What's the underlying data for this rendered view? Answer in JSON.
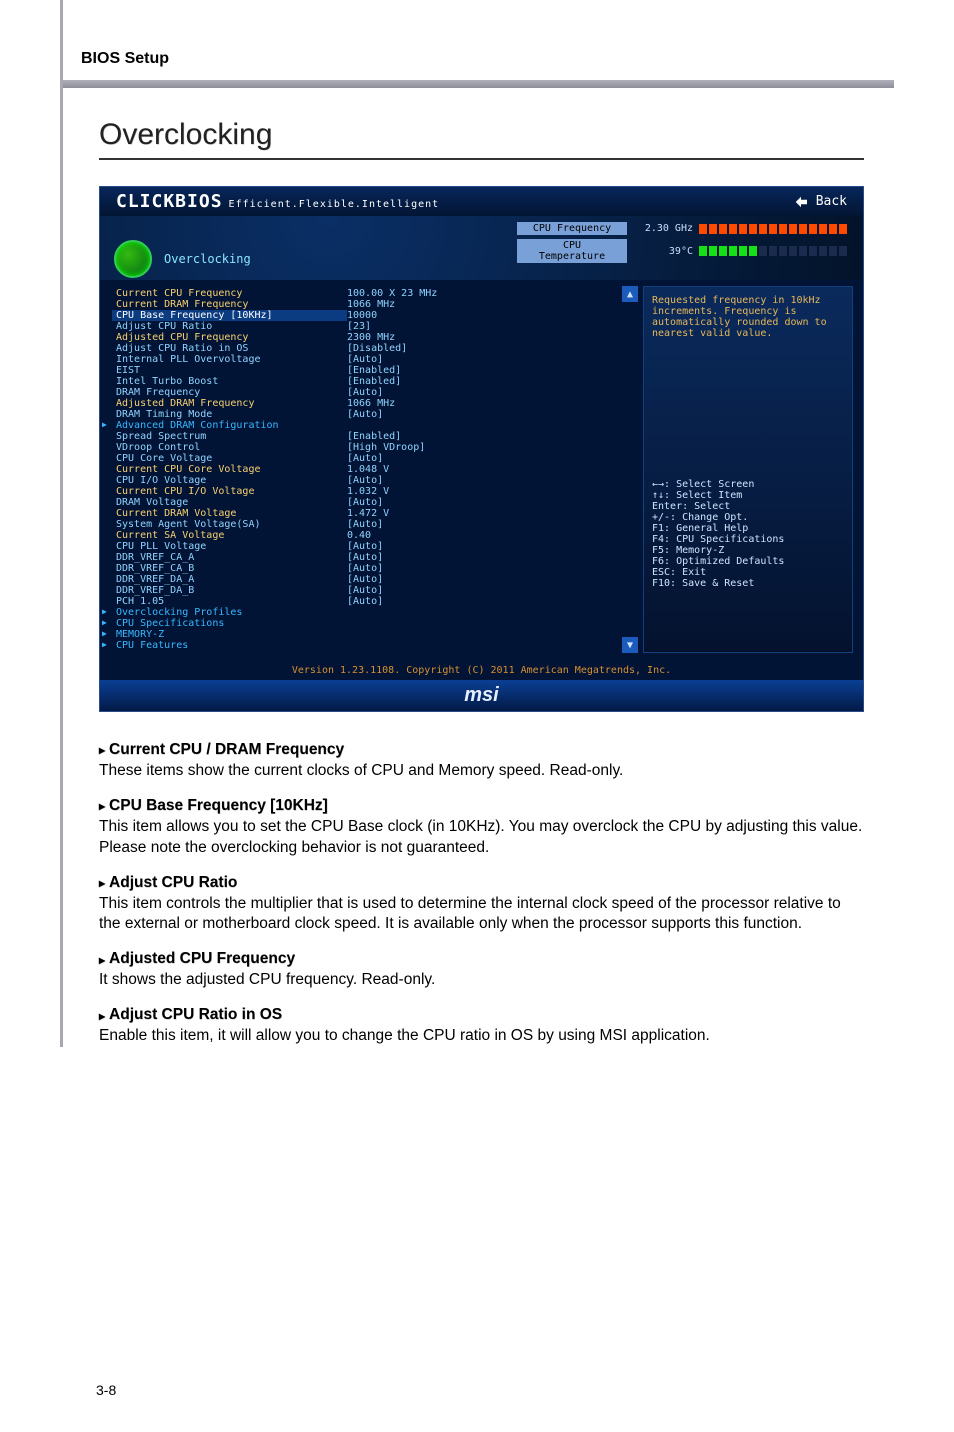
{
  "page": {
    "header": "BIOS Setup",
    "title": "Overclocking",
    "page_number": "3-8"
  },
  "bios": {
    "logo": "CLICKBIOS",
    "logo_tag": "Efficient.Flexible.Intelligent",
    "back": "Back",
    "section_label": "Overclocking",
    "gauges": {
      "cpu_freq_label": "CPU Frequency",
      "cpu_freq_value": "2.30 GHz",
      "cpu_temp_label": "CPU Temperature",
      "cpu_temp_value": "39°C"
    },
    "settings": [
      {
        "k": "Current CPU Frequency",
        "v": "100.00 X 23 MHz",
        "cls": "hl"
      },
      {
        "k": "Current DRAM Frequency",
        "v": "1066 MHz",
        "cls": "hl"
      },
      {
        "k": "CPU Base Frequency [10KHz]",
        "v": "10000",
        "cls": "sel"
      },
      {
        "k": "Adjust CPU Ratio",
        "v": "[23]",
        "cls": ""
      },
      {
        "k": "Adjusted CPU Frequency",
        "v": "2300 MHz",
        "cls": "hl"
      },
      {
        "k": "Adjust CPU Ratio in OS",
        "v": "[Disabled]",
        "cls": ""
      },
      {
        "k": "Internal PLL Overvoltage",
        "v": "[Auto]",
        "cls": ""
      },
      {
        "k": "EIST",
        "v": "[Enabled]",
        "cls": ""
      },
      {
        "k": "Intel Turbo Boost",
        "v": "[Enabled]",
        "cls": ""
      },
      {
        "k": "DRAM Frequency",
        "v": "[Auto]",
        "cls": ""
      },
      {
        "k": "Adjusted DRAM Frequency",
        "v": "1066 MHz",
        "cls": "hl"
      },
      {
        "k": "DRAM Timing Mode",
        "v": "[Auto]",
        "cls": ""
      },
      {
        "k": "Advanced DRAM Configuration",
        "v": "",
        "cls": "submenu"
      },
      {
        "k": "Spread Spectrum",
        "v": "[Enabled]",
        "cls": ""
      },
      {
        "k": "VDroop Control",
        "v": "[High VDroop]",
        "cls": ""
      },
      {
        "k": "CPU Core Voltage",
        "v": "[Auto]",
        "cls": ""
      },
      {
        "k": "Current CPU Core Voltage",
        "v": "1.048 V",
        "cls": "hl"
      },
      {
        "k": "CPU I/O Voltage",
        "v": "[Auto]",
        "cls": ""
      },
      {
        "k": "Current CPU I/O Voltage",
        "v": "1.032 V",
        "cls": "hl"
      },
      {
        "k": "DRAM Voltage",
        "v": "[Auto]",
        "cls": ""
      },
      {
        "k": "Current DRAM Voltage",
        "v": "1.472 V",
        "cls": "hl"
      },
      {
        "k": "System Agent Voltage(SA)",
        "v": "[Auto]",
        "cls": ""
      },
      {
        "k": "Current SA Voltage",
        "v": "0.40",
        "cls": "hl"
      },
      {
        "k": "CPU PLL Voltage",
        "v": "[Auto]",
        "cls": ""
      },
      {
        "k": "DDR_VREF_CA_A",
        "v": "[Auto]",
        "cls": ""
      },
      {
        "k": "DDR_VREF_CA_B",
        "v": "[Auto]",
        "cls": ""
      },
      {
        "k": "DDR_VREF_DA_A",
        "v": "[Auto]",
        "cls": ""
      },
      {
        "k": "DDR_VREF_DA_B",
        "v": "[Auto]",
        "cls": ""
      },
      {
        "k": "PCH 1.05",
        "v": "[Auto]",
        "cls": ""
      },
      {
        "k": "Overclocking Profiles",
        "v": "",
        "cls": "submenu"
      },
      {
        "k": "CPU Specifications",
        "v": "",
        "cls": "submenu"
      },
      {
        "k": "MEMORY-Z",
        "v": "",
        "cls": "submenu"
      },
      {
        "k": "CPU Features",
        "v": "",
        "cls": "submenu"
      }
    ],
    "help": {
      "desc": "Requested frequency in 10kHz increments. Frequency is automatically rounded down to nearest valid value.",
      "keys": [
        "←→: Select Screen",
        "↑↓: Select Item",
        "Enter: Select",
        "+/-: Change Opt.",
        "F1: General Help",
        "F4: CPU Specifications",
        "F5: Memory-Z",
        "F6: Optimized Defaults",
        "ESC: Exit",
        "F10: Save & Reset"
      ]
    },
    "footer": "Version 1.23.1108. Copyright (C) 2011 American Megatrends, Inc.",
    "brand": "msi"
  },
  "doc": {
    "s1_h": "Current CPU / DRAM Frequency",
    "s1_b": "These items show the current clocks of CPU and Memory speed. Read-only.",
    "s2_h": "CPU Base Frequency [10KHz]",
    "s2_b": "This item allows you to set the CPU Base clock (in 10KHz). You may overclock the CPU by adjusting this value. Please note the overclocking behavior is not guaranteed.",
    "s3_h": "Adjust CPU Ratio",
    "s3_b": "This item controls the multiplier that is used to determine the internal clock speed of the processor relative to the external or motherboard clock speed. It is available only when the processor supports this function.",
    "s4_h": "Adjusted CPU Frequency",
    "s4_b": "It shows the adjusted CPU frequency. Read-only.",
    "s5_h": "Adjust CPU Ratio in OS",
    "s5_b": "Enable this item, it will allow you to change the CPU ratio in OS by using MSI application."
  }
}
